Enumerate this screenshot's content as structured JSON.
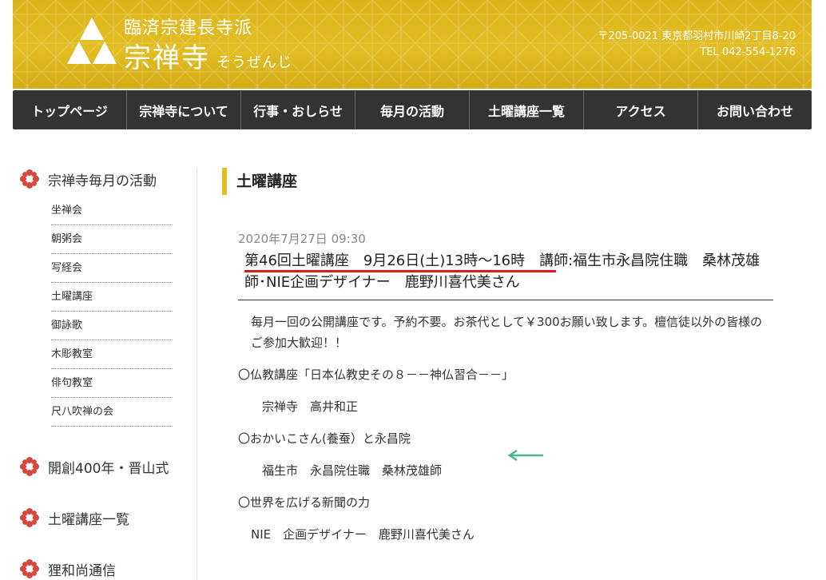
{
  "header": {
    "sect": "臨済宗建長寺派",
    "temple_name": "宗禅寺",
    "temple_reading": "そうぜんじ",
    "address": "〒205-0021 東京都羽村市川崎2丁目8-20",
    "tel": "TEL 042-554-1276"
  },
  "nav": [
    {
      "label": "トップページ"
    },
    {
      "label": "宗禅寺について"
    },
    {
      "label": "行事・おしらせ"
    },
    {
      "label": "毎月の活動"
    },
    {
      "label": "土曜講座一覧"
    },
    {
      "label": "アクセス"
    },
    {
      "label": "お問い合わせ"
    }
  ],
  "sidebar": {
    "section1": "宗禅寺毎月の活動",
    "items": [
      {
        "label": "坐禅会"
      },
      {
        "label": "朝粥会"
      },
      {
        "label": "写経会"
      },
      {
        "label": "土曜講座"
      },
      {
        "label": "御詠歌"
      },
      {
        "label": "木彫教室"
      },
      {
        "label": "俳句教室"
      },
      {
        "label": "尺八吹禅の会"
      }
    ],
    "section2": "開創400年・晋山式",
    "section3": "土曜講座一覧",
    "section4": "狸和尚通信"
  },
  "main": {
    "page_title": "土曜講座",
    "post": {
      "date": "2020年7月27日 09:30",
      "title": "第46回土曜講座　9月26日(土)13時～16時　講師:福生市永昌院住職　桑林茂雄師･NIE企画デザイナー　鹿野川喜代美さん",
      "paragraphs": [
        "毎月一回の公開講座です。予約不要。お茶代として￥300お願い致します。檀信徒以外の皆様のご参加大歓迎！！",
        "〇仏教講座「日本仏教史その８－－神仏習合－－」",
        "宗禅寺　高井和正",
        "〇おかいこさん(養蚕）と永昌院",
        "福生市　永昌院住職　桑林茂雄師",
        "〇世界を広げる新聞の力",
        "NIE　企画デザイナー　鹿野川喜代美さん"
      ]
    }
  },
  "colors": {
    "header_gold": "#e2bd24",
    "nav_bg": "#333333",
    "flower_red": "#d9473a",
    "underline_red": "#e01a1a",
    "arrow_green": "#4cb88a"
  },
  "icons": {
    "logo": "triforce-logo-icon",
    "sidebar_bullet": "flower-icon",
    "annotation": "arrow-left-icon"
  }
}
